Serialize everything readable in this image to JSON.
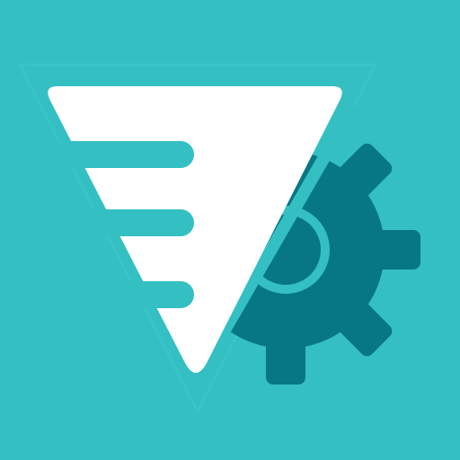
{
  "icon": {
    "name": "triangle-gear-app-icon",
    "background_color": "#34c0c3",
    "triangle_color": "#ffffff",
    "gear_color": "#077783",
    "stripe_color": "#34c0c3",
    "symbols": [
      "inverted-triangle-icon",
      "gear-icon",
      "speed-lines"
    ]
  }
}
